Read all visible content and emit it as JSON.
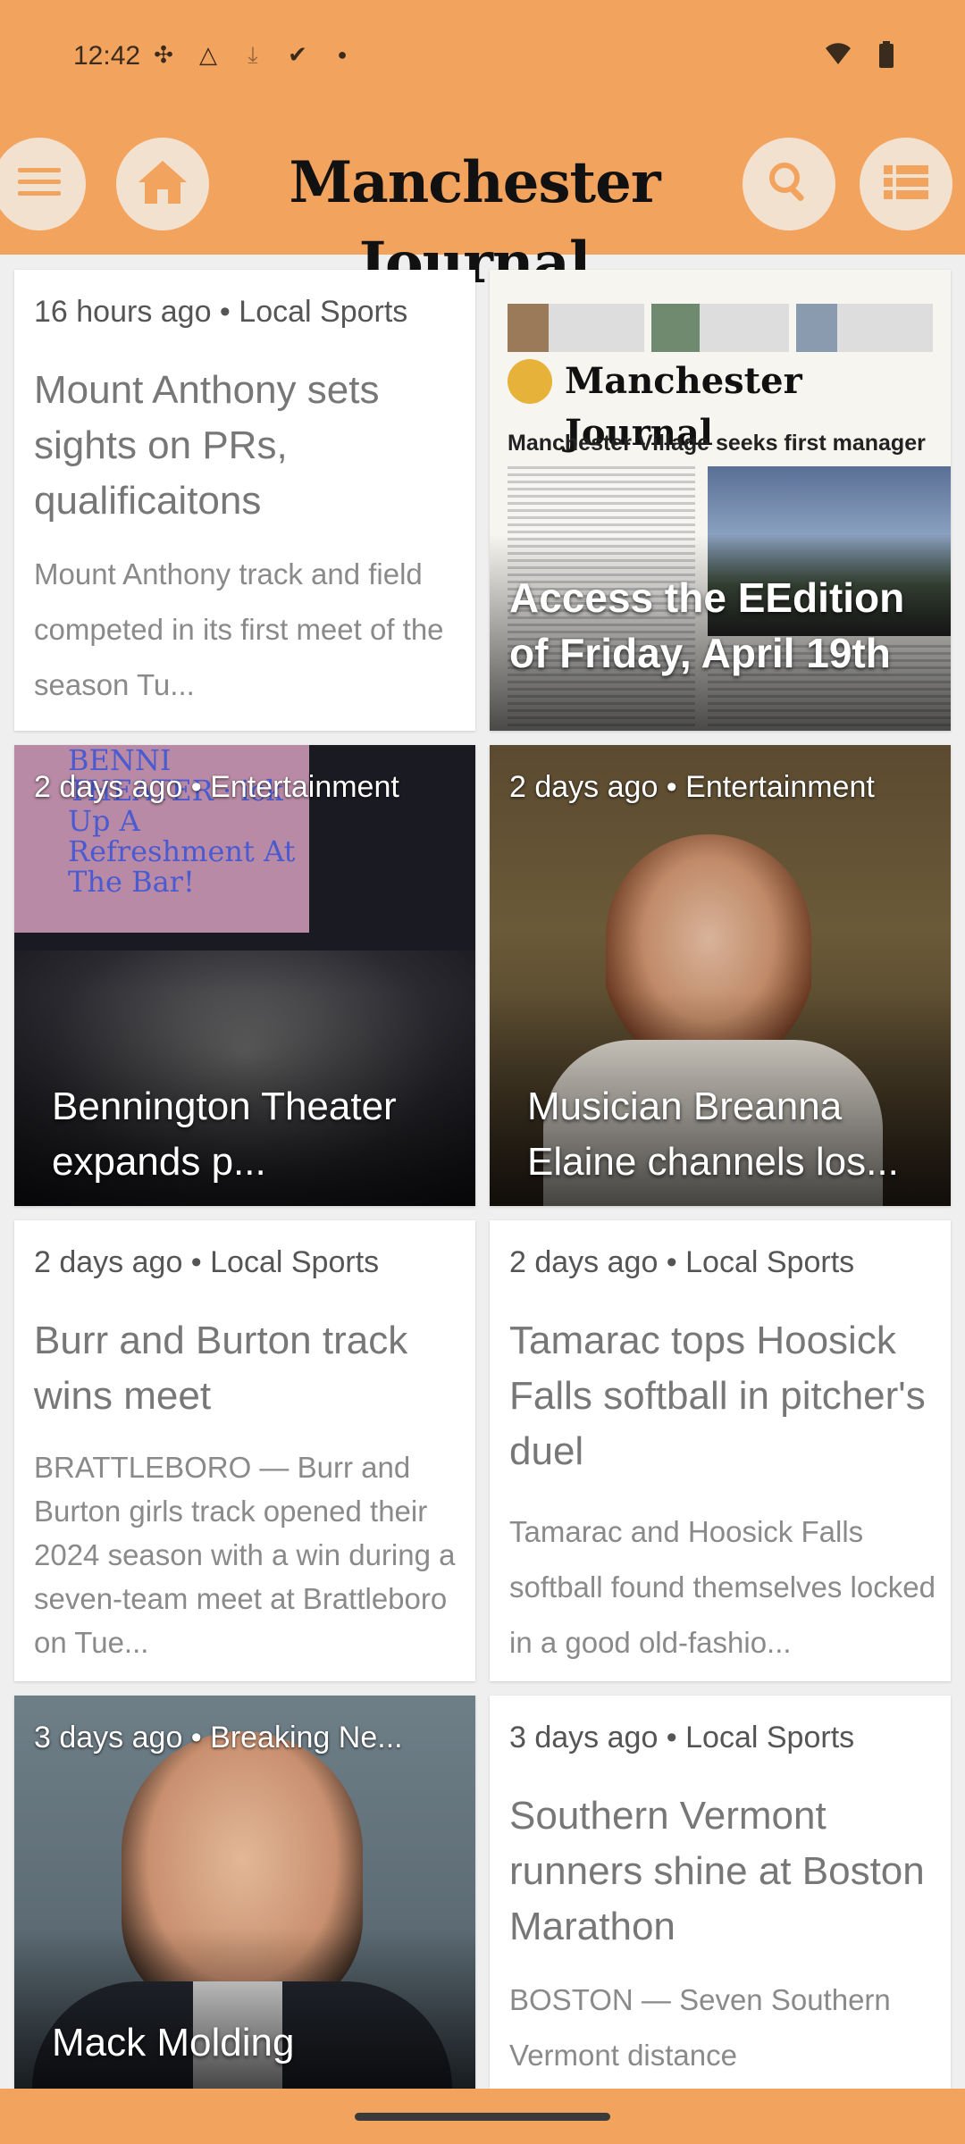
{
  "status_bar": {
    "time": "12:42",
    "left_icons": [
      "slack-icon",
      "drive-icon",
      "download-icon",
      "check-icon",
      "dot-icon"
    ],
    "right_icons": [
      "wifi-icon",
      "battery-icon"
    ]
  },
  "header": {
    "title": "Manchester Journal",
    "buttons": [
      "menu-icon",
      "home-icon",
      "search-icon",
      "list-icon"
    ],
    "accent_color": "#f2a35e"
  },
  "cards": [
    {
      "meta": "16 hours ago • Local Sports",
      "headline": "Mount Anthony sets sights on PRs, qualificaitons",
      "summary": "Mount Anthony track and field competed in its first meet of the season Tu..."
    },
    {
      "headline": "Access the EEdition of Friday, April 19th",
      "newspaper_masthead": "Manchester Journal",
      "newspaper_headline": "Manchester Village seeks first manager"
    },
    {
      "meta": "2 days ago • Entertainment",
      "headline": "Bennington Theater expands p...",
      "image_text": "BENNI THEATER · ick Up A Refreshment At The Bar!"
    },
    {
      "meta": "2 days ago • Entertainment",
      "headline": "Musician Breanna Elaine channels los..."
    },
    {
      "meta": "2 days ago • Local Sports",
      "headline": "Burr and Burton track wins meet",
      "summary": "BRATTLEBORO — Burr and Burton girls track opened their 2024 season with a win during a seven-team meet at Brattleboro on Tue..."
    },
    {
      "meta": "2 days ago • Local Sports",
      "headline": "Tamarac tops Hoosick Falls softball in pitcher's duel",
      "summary": "Tamarac and Hoosick Falls softball found themselves locked in a good old-fashio..."
    },
    {
      "meta": "3 days ago • Breaking Ne...",
      "headline": "Mack Molding"
    },
    {
      "meta": "3 days ago • Local Sports",
      "headline": "Southern Vermont runners shine at Boston Marathon",
      "summary": "BOSTON — Seven Southern Vermont distance"
    }
  ]
}
